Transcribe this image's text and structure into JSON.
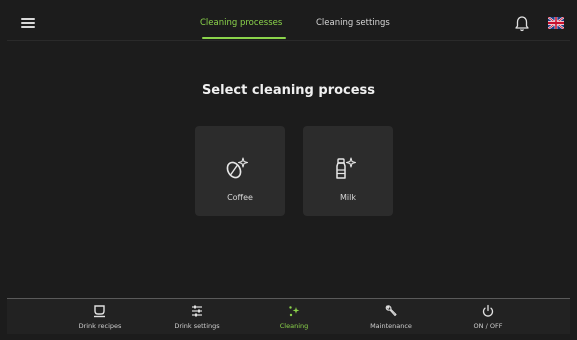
{
  "header": {
    "tabs": [
      {
        "label": "Cleaning processes",
        "active": true
      },
      {
        "label": "Cleaning settings",
        "active": false
      }
    ]
  },
  "main": {
    "title": "Select cleaning process",
    "options": [
      {
        "label": "Coffee",
        "icon": "coffee-bean-sparkle-icon"
      },
      {
        "label": "Milk",
        "icon": "milk-bottle-sparkle-icon"
      }
    ]
  },
  "bottom_nav": {
    "items": [
      {
        "label": "Drink recipes",
        "icon": "cup-icon",
        "active": false
      },
      {
        "label": "Drink settings",
        "icon": "sliders-icon",
        "active": false
      },
      {
        "label": "Cleaning",
        "icon": "sparkle-icon",
        "active": true
      },
      {
        "label": "Maintenance",
        "icon": "wrench-icon",
        "active": false
      },
      {
        "label": "ON / OFF",
        "icon": "power-icon",
        "active": false
      }
    ]
  },
  "colors": {
    "accent": "#8bd44b",
    "background": "#1c1c1c",
    "card": "#2c2c2c"
  }
}
